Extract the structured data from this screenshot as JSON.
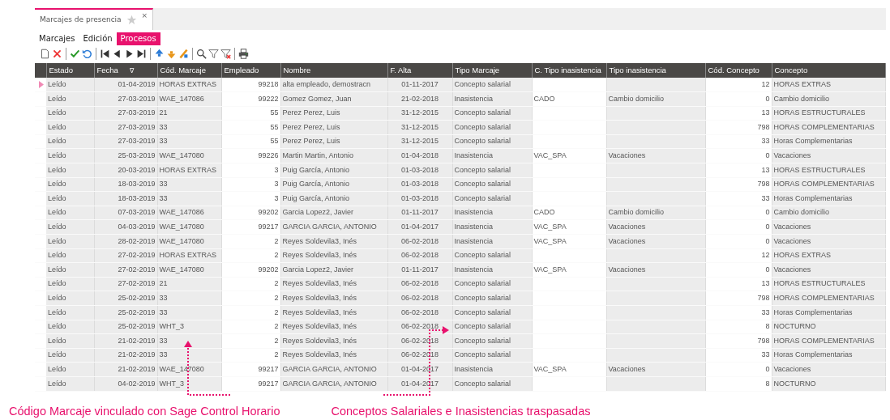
{
  "tab": {
    "label": "Marcajes de presencia",
    "selected": true,
    "close": "×"
  },
  "menu": [
    {
      "label": "Marcajes",
      "selected": false
    },
    {
      "label": "Edición",
      "selected": false
    },
    {
      "label": "Procesos",
      "selected": true
    }
  ],
  "toolbar": [
    {
      "kind": "new"
    },
    {
      "kind": "delete"
    },
    {
      "kind": "sep"
    },
    {
      "kind": "accept"
    },
    {
      "kind": "undo"
    },
    {
      "kind": "sep"
    },
    {
      "kind": "first"
    },
    {
      "kind": "prev"
    },
    {
      "kind": "next"
    },
    {
      "kind": "last"
    },
    {
      "kind": "sep"
    },
    {
      "kind": "up"
    },
    {
      "kind": "down"
    },
    {
      "kind": "sort"
    },
    {
      "kind": "sep"
    },
    {
      "kind": "search"
    },
    {
      "kind": "filter"
    },
    {
      "kind": "clearfilter"
    },
    {
      "kind": "sep"
    },
    {
      "kind": "print"
    }
  ],
  "table": {
    "columns": [
      {
        "label": "Estado",
        "editable": false
      },
      {
        "label": "Fecha",
        "editable": false,
        "sort_mark": "∇"
      },
      {
        "label": "Cód. Marcaje",
        "editable": false
      },
      {
        "label": "Empleado",
        "editable": true
      },
      {
        "label": "Nombre",
        "editable": false
      },
      {
        "label": "F. Alta",
        "editable": false
      },
      {
        "label": "Tipo Marcaje",
        "editable": false
      },
      {
        "label": "C. Tipo inasistencia",
        "editable": true
      },
      {
        "label": "Tipo inasistencia",
        "editable": false
      },
      {
        "label": "Cód. Concepto",
        "editable": true
      },
      {
        "label": "Concepto",
        "editable": false
      }
    ],
    "rows": [
      {
        "selected": true,
        "cells": [
          "Leído",
          "01-04-2019",
          "HORAS EXTRAS",
          "99218",
          "alta empleado, demostracn",
          "01-11-2017",
          "Concepto salarial",
          null,
          null,
          "12",
          "HORAS EXTRAS"
        ]
      },
      {
        "selected": false,
        "cells": [
          "Leído",
          "27-03-2019",
          "WAE_147086",
          "99222",
          "Gomez Gomez, Juan",
          "21-02-2018",
          "Inasistencia",
          "CADO",
          "Cambio domicilio",
          "0",
          "Cambio domicilio"
        ]
      },
      {
        "selected": false,
        "cells": [
          "Leído",
          "27-03-2019",
          "21",
          "55",
          "Perez Perez, Luis",
          "31-12-2015",
          "Concepto salarial",
          null,
          null,
          "13",
          "HORAS ESTRUCTURALES"
        ]
      },
      {
        "selected": false,
        "cells": [
          "Leído",
          "27-03-2019",
          "33",
          "55",
          "Perez Perez, Luis",
          "31-12-2015",
          "Concepto salarial",
          null,
          null,
          "798",
          "HORAS COMPLEMENTARIAS"
        ]
      },
      {
        "selected": false,
        "cells": [
          "Leído",
          "27-03-2019",
          "33",
          "55",
          "Perez Perez, Luis",
          "31-12-2015",
          "Concepto salarial",
          null,
          null,
          "33",
          "Horas Complementarias"
        ]
      },
      {
        "selected": false,
        "cells": [
          "Leído",
          "25-03-2019",
          "WAE_147080",
          "99226",
          "Martin Martin, Antonio",
          "01-04-2018",
          "Inasistencia",
          "VAC_SPA",
          "Vacaciones",
          "0",
          "Vacaciones"
        ]
      },
      {
        "selected": false,
        "cells": [
          "Leído",
          "20-03-2019",
          "HORAS EXTRAS",
          "3",
          "Puig García, Antonio",
          "01-03-2018",
          "Concepto salarial",
          null,
          null,
          "13",
          "HORAS ESTRUCTURALES"
        ]
      },
      {
        "selected": false,
        "cells": [
          "Leído",
          "18-03-2019",
          "33",
          "3",
          "Puig García, Antonio",
          "01-03-2018",
          "Concepto salarial",
          null,
          null,
          "798",
          "HORAS COMPLEMENTARIAS"
        ]
      },
      {
        "selected": false,
        "cells": [
          "Leído",
          "18-03-2019",
          "33",
          "3",
          "Puig García, Antonio",
          "01-03-2018",
          "Concepto salarial",
          null,
          null,
          "33",
          "Horas Complementarias"
        ]
      },
      {
        "selected": false,
        "cells": [
          "Leído",
          "07-03-2019",
          "WAE_147086",
          "99202",
          "Garcia Lopez2, Javier",
          "01-11-2017",
          "Inasistencia",
          "CADO",
          "Cambio domicilio",
          "0",
          "Cambio domicilio"
        ]
      },
      {
        "selected": false,
        "cells": [
          "Leído",
          "04-03-2019",
          "WAE_147080",
          "99217",
          "GARCIA GARCIA, ANTONIO",
          "01-04-2017",
          "Inasistencia",
          "VAC_SPA",
          "Vacaciones",
          "0",
          "Vacaciones"
        ]
      },
      {
        "selected": false,
        "cells": [
          "Leído",
          "28-02-2019",
          "WAE_147080",
          "2",
          "Reyes Soldevila3, Inés",
          "06-02-2018",
          "Inasistencia",
          "VAC_SPA",
          "Vacaciones",
          "0",
          "Vacaciones"
        ]
      },
      {
        "selected": false,
        "cells": [
          "Leído",
          "27-02-2019",
          "HORAS EXTRAS",
          "2",
          "Reyes Soldevila3, Inés",
          "06-02-2018",
          "Concepto salarial",
          null,
          null,
          "12",
          "HORAS EXTRAS"
        ]
      },
      {
        "selected": false,
        "cells": [
          "Leído",
          "27-02-2019",
          "WAE_147080",
          "99202",
          "Garcia Lopez2, Javier",
          "01-11-2017",
          "Inasistencia",
          "VAC_SPA",
          "Vacaciones",
          "0",
          "Vacaciones"
        ]
      },
      {
        "selected": false,
        "cells": [
          "Leído",
          "27-02-2019",
          "21",
          "2",
          "Reyes Soldevila3, Inés",
          "06-02-2018",
          "Concepto salarial",
          null,
          null,
          "13",
          "HORAS ESTRUCTURALES"
        ]
      },
      {
        "selected": false,
        "cells": [
          "Leído",
          "25-02-2019",
          "33",
          "2",
          "Reyes Soldevila3, Inés",
          "06-02-2018",
          "Concepto salarial",
          null,
          null,
          "798",
          "HORAS COMPLEMENTARIAS"
        ]
      },
      {
        "selected": false,
        "cells": [
          "Leído",
          "25-02-2019",
          "33",
          "2",
          "Reyes Soldevila3, Inés",
          "06-02-2018",
          "Concepto salarial",
          null,
          null,
          "33",
          "Horas Complementarias"
        ]
      },
      {
        "selected": false,
        "cells": [
          "Leído",
          "25-02-2019",
          "WHT_3",
          "2",
          "Reyes Soldevila3, Inés",
          "06-02-2018",
          "Concepto salarial",
          null,
          null,
          "8",
          "NOCTURNO"
        ]
      },
      {
        "selected": false,
        "cells": [
          "Leído",
          "21-02-2019",
          "33",
          "2",
          "Reyes Soldevila3, Inés",
          "06-02-2018",
          "Concepto salarial",
          null,
          null,
          "798",
          "HORAS COMPLEMENTARIAS"
        ]
      },
      {
        "selected": false,
        "cells": [
          "Leído",
          "21-02-2019",
          "33",
          "2",
          "Reyes Soldevila3, Inés",
          "06-02-2018",
          "Concepto salarial",
          null,
          null,
          "33",
          "Horas Complementarias"
        ]
      },
      {
        "selected": false,
        "cells": [
          "Leído",
          "21-02-2019",
          "WAE_147080",
          "99217",
          "GARCIA GARCIA, ANTONIO",
          "01-04-2017",
          "Inasistencia",
          "VAC_SPA",
          "Vacaciones",
          "0",
          "Vacaciones"
        ]
      },
      {
        "selected": false,
        "cells": [
          "Leído",
          "04-02-2019",
          "WHT_3",
          "99217",
          "GARCIA GARCIA, ANTONIO",
          "01-04-2017",
          "Concepto salarial",
          null,
          null,
          "8",
          "NOCTURNO"
        ]
      }
    ]
  },
  "annotations": [
    "Código Marcaje vinculado con Sage Control Horario",
    "Conceptos Salariales e Inasistencias traspasadas"
  ]
}
